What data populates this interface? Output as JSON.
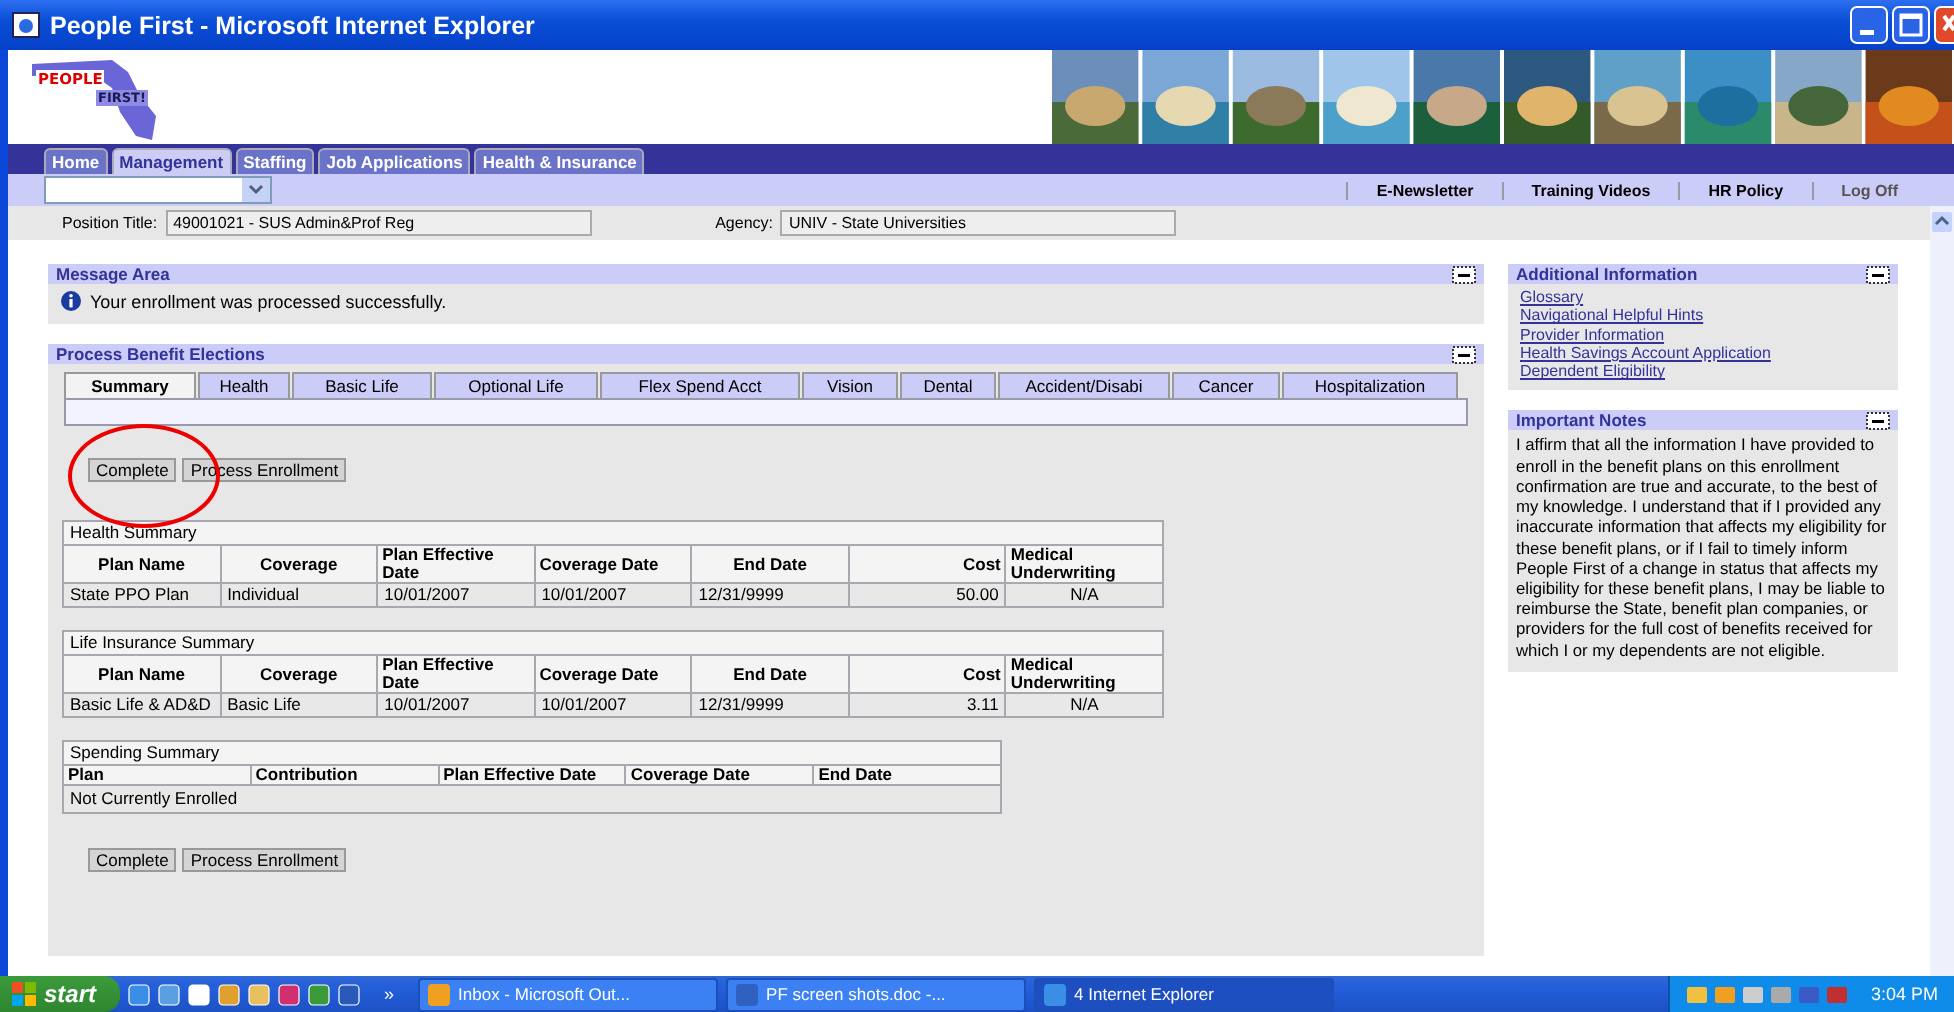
{
  "window": {
    "title": "People First - Microsoft Internet Explorer"
  },
  "logo": {
    "line_1": "PEOPLE",
    "line_2": "FIRST!"
  },
  "nav_tabs": [
    {
      "label": "Home",
      "selected": false
    },
    {
      "label": "Management",
      "selected": true
    },
    {
      "label": "Staffing",
      "selected": false
    },
    {
      "label": "Job Applications",
      "selected": false
    },
    {
      "label": "Health & Insurance",
      "selected": false
    }
  ],
  "toolbar": {
    "links": [
      "E-Newsletter",
      "Training Videos",
      "HR Policy",
      "Log Off"
    ]
  },
  "position": {
    "label": "Position Title:",
    "value": "49001021 - SUS Admin&Prof Reg",
    "agency_label": "Agency:",
    "agency_value": "UNIV - State Universities"
  },
  "message_area": {
    "title": "Message Area",
    "message": "Your enrollment was processed successfully."
  },
  "process_benefit_elections": {
    "title": "Process Benefit Elections",
    "tabs": [
      {
        "label": "Summary",
        "selected": true
      },
      {
        "label": "Health",
        "selected": false
      },
      {
        "label": "Basic Life",
        "selected": false
      },
      {
        "label": "Optional Life",
        "selected": false
      },
      {
        "label": "Flex Spend Acct",
        "selected": false
      },
      {
        "label": "Vision",
        "selected": false
      },
      {
        "label": "Dental",
        "selected": false
      },
      {
        "label": "Accident/Disabi",
        "selected": false
      },
      {
        "label": "Cancer",
        "selected": false
      },
      {
        "label": "Hospitalization",
        "selected": false
      }
    ],
    "buttons_top": [
      "Complete",
      "Process Enrollment"
    ],
    "tables": [
      {
        "title": "Health Summary",
        "columns": [
          "Plan Name",
          "Coverage",
          "Plan Effective Date",
          "Coverage Date",
          "End Date",
          "Cost",
          "Medical Underwriting"
        ],
        "rows": [
          [
            "State PPO Plan",
            "Individual",
            "10/01/2007",
            "10/01/2007",
            "12/31/9999",
            "50.00",
            "N/A"
          ]
        ]
      },
      {
        "title": "Life Insurance Summary",
        "columns": [
          "Plan Name",
          "Coverage",
          "Plan Effective Date",
          "Coverage Date",
          "End Date",
          "Cost",
          "Medical Underwriting"
        ],
        "rows": [
          [
            "Basic Life & AD&D",
            "Basic Life",
            "10/01/2007",
            "10/01/2007",
            "12/31/9999",
            "3.11",
            "N/A"
          ]
        ]
      },
      {
        "title": "Spending Summary",
        "columns": [
          "Plan",
          "Contribution",
          "Plan Effective Date",
          "Coverage Date",
          "End Date"
        ],
        "empty_message": "Not Currently Enrolled"
      }
    ],
    "buttons_bottom": [
      "Complete",
      "Process Enrollment"
    ]
  },
  "additional_information": {
    "title": "Additional Information",
    "links": [
      "Glossary",
      "Navigational Helpful Hints",
      "Provider Information",
      "Health Savings Account Application",
      "Dependent Eligibility"
    ]
  },
  "important_notes": {
    "title": "Important Notes",
    "text": "I affirm that all the information I have provided to enroll in the benefit plans on this enrollment confirmation are true and accurate, to the best of my knowledge. I understand that if I provided any inaccurate information that affects my eligibility for these benefit plans, or if I fail to timely inform People First of a change in status that affects my eligibility for these benefit plans, I may be liable to reimburse the State, benefit plan companies, or providers for the full cost of benefits received for which I or my dependents are not eligible."
  },
  "taskbar": {
    "start": "start",
    "more": "»",
    "tasks": [
      {
        "label": "Inbox - Microsoft Out...",
        "selected": false
      },
      {
        "label": "PF screen shots.doc -...",
        "selected": false
      },
      {
        "label": "4 Internet Explorer",
        "selected": true
      }
    ],
    "clock": "3:04 PM"
  }
}
